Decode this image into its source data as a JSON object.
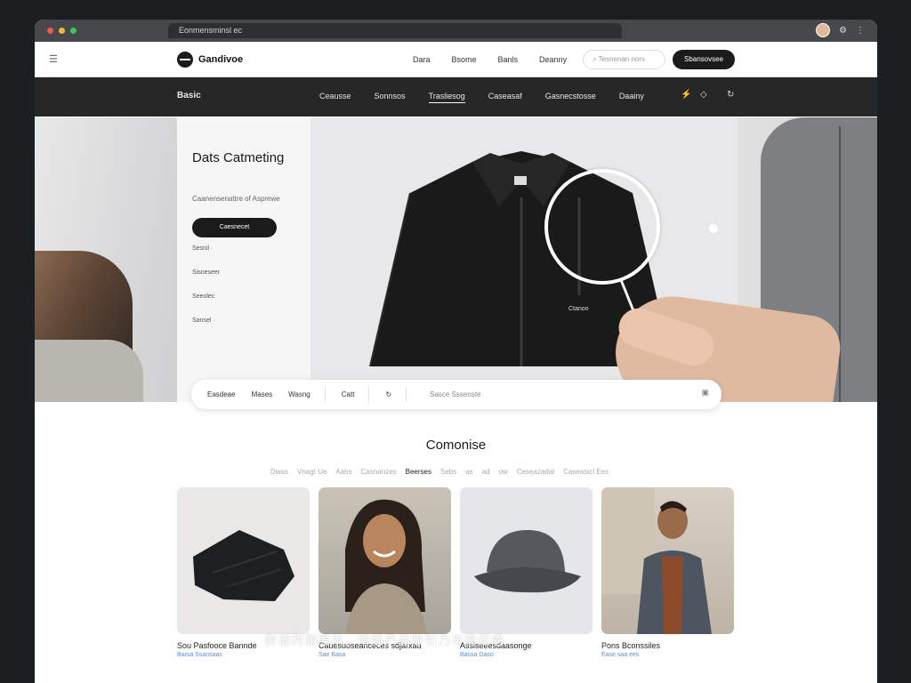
{
  "browser": {
    "tab_title": "Eonmensminsl ec",
    "dot_colors": [
      "#f05a4f",
      "#f4b63c",
      "#3cc55a"
    ]
  },
  "topnav": {
    "menu_icon": "menu-icon",
    "logo": "Gandivoe",
    "links": [
      "Dara",
      "Bsome",
      "Banls",
      "Deanny"
    ],
    "search_placeholder": "Tesnenan nors",
    "button": "Sbansovsee"
  },
  "catbar": {
    "brand": "Basic",
    "categories": [
      "Ceausse",
      "Sonnsos",
      "Trasliesog",
      "Caseasaf",
      "Gasnecstosse",
      "Daainy"
    ],
    "active_category": "Trasliesog"
  },
  "hero": {
    "title": "Dats Catmeting",
    "subtitle": "Caanensenattre of Asprewe",
    "cta": "Caesnecet",
    "product_links": [
      "Sesnil ·",
      "Sisneseer",
      "Seeolec",
      "Sansel ·"
    ],
    "jacket_label": "Ctanoo"
  },
  "filterbar": {
    "items": [
      "Easdeae",
      "Mases",
      "Wasng",
      "Catt"
    ],
    "search_placeholder": "Sasce Sssenste"
  },
  "collection": {
    "title": "Comonise",
    "tabs": [
      "Dwas",
      "Vnagt Ue",
      "Aahs",
      "Casnanzes",
      "Beerses",
      "Sebs",
      "as",
      "ad",
      "ow",
      "Ceseazadal",
      "Caseatscl Ees"
    ],
    "active_tab": "Beerses",
    "cards": [
      {
        "name": "Sou Pasfooce Bannde",
        "price": "Barsa  Ssansaas"
      },
      {
        "name": "Cauesuoseanceces sdjarxad",
        "price": "Sae  Basa"
      },
      {
        "name": "Assiseeesdaasonge",
        "price": "Bassa Daso"
      },
      {
        "name": "Pons Bconssiles",
        "price": "Ease saa ees"
      }
    ]
  },
  "overlay_caption": "突请利润展示，增强产品吸引力与信任感"
}
